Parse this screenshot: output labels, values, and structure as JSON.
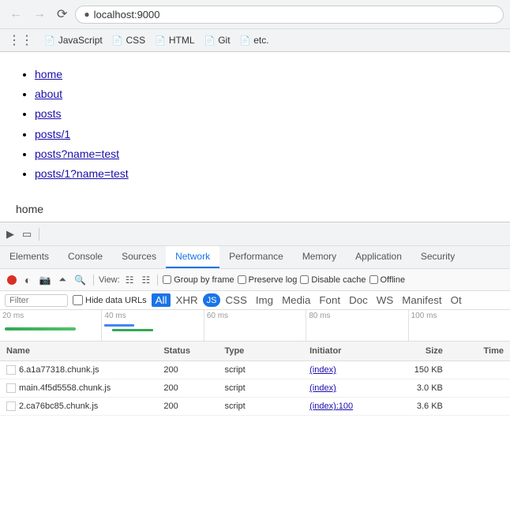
{
  "browser": {
    "back_disabled": true,
    "forward_disabled": true,
    "url": "localhost:9000",
    "bookmarks": [
      {
        "label": "JavaScript",
        "icon": "📄"
      },
      {
        "label": "CSS",
        "icon": "📄"
      },
      {
        "label": "HTML",
        "icon": "📄"
      },
      {
        "label": "Git",
        "icon": "📄"
      },
      {
        "label": "etc.",
        "icon": "📄"
      }
    ]
  },
  "page": {
    "links": [
      "home",
      "about",
      "posts",
      "posts/1",
      "posts?name=test",
      "posts/1?name=test"
    ],
    "current_text": "home"
  },
  "devtools": {
    "tabs": [
      "Elements",
      "Console",
      "Sources",
      "Network",
      "Performance",
      "Memory",
      "Application",
      "Security"
    ],
    "active_tab": "Network",
    "toolbar": {
      "view_label": "View:",
      "group_by_frame_label": "Group by frame",
      "preserve_log_label": "Preserve log",
      "disable_cache_label": "Disable cache",
      "offline_label": "Offline"
    },
    "filter": {
      "placeholder": "Filter",
      "hide_data_urls_label": "Hide data URLs",
      "tabs": [
        "All",
        "XHR",
        "JS",
        "CSS",
        "Img",
        "Media",
        "Font",
        "Doc",
        "WS",
        "Manifest",
        "Other"
      ],
      "active_tab": "All",
      "active_type": "JS"
    },
    "timeline": {
      "marks": [
        "20 ms",
        "40 ms",
        "60 ms",
        "80 ms",
        "100 ms"
      ]
    },
    "table": {
      "headers": [
        "Name",
        "Status",
        "Type",
        "Initiator",
        "Size",
        "Time"
      ],
      "rows": [
        {
          "name": "6.a1a77318.chunk.js",
          "status": "200",
          "type": "script",
          "initiator": "(index)",
          "size": "150 KB",
          "time": ""
        },
        {
          "name": "main.4f5d5558.chunk.js",
          "status": "200",
          "type": "script",
          "initiator": "(index)",
          "size": "3.0 KB",
          "time": ""
        },
        {
          "name": "2.ca76bc85.chunk.js",
          "status": "200",
          "type": "script",
          "initiator": "(index):100",
          "size": "3.6 KB",
          "time": ""
        }
      ]
    }
  }
}
